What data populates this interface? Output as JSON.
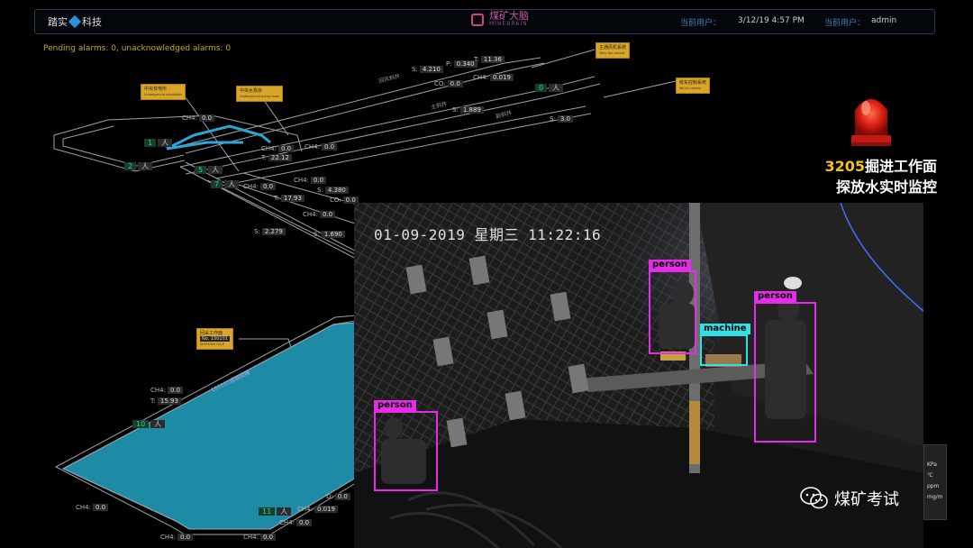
{
  "header": {
    "left_logo_a": "踏实",
    "left_logo_b": "科技",
    "brand_name": "煤矿大脑",
    "brand_sub": "MINEBRAIN",
    "user_label_1": "当前用户：",
    "datetime": "3/12/19 4:57 PM",
    "user_label_2": "当前用户：",
    "username": "admin"
  },
  "alarm_status": "Pending alarms: 0, unacknowledged alarms: 0",
  "map": {
    "boxes": {
      "main_fan": {
        "title": "主通风机系统",
        "sub": "Main fan control"
      },
      "winch": {
        "title": "绞车控制系统",
        "sub": "Winch control"
      },
      "substation": {
        "title": "中央变电所",
        "sub": "Underground substation"
      },
      "pump": {
        "title": "中央水泵房",
        "sub": "Underground pump room"
      },
      "face": {
        "title": "回采工作面",
        "no": "No. 150101",
        "sub": "WORKING FACE"
      }
    },
    "tunnel_labels": {
      "return_air": "回风斜井",
      "main": "主斜井",
      "aux": "副斜井",
      "face_roadway": "150101运输顺槽"
    },
    "readings": {
      "r1_label": "S:",
      "r1": "4.210",
      "r2_label": "P:",
      "r2": "0.340",
      "r3_label": "T:",
      "r3": "11.36",
      "r4_label": "CO:",
      "r4": "0.0",
      "r5_label": "CH4:",
      "r5": "0.019",
      "r6_label": "S:",
      "r6": "1.889",
      "r7_label": "S:",
      "r7": "3.0",
      "r8_label": "CH4:",
      "r8": "0.0",
      "r9_label": "CH4:",
      "r9": "0.0",
      "r10_label": "T:",
      "r10": "22.12",
      "r11_label": "CH4:",
      "r11": "0.0",
      "r12_label": "CH4:",
      "r12": "0.0",
      "r13_label": "CH4:",
      "r13": "0.0",
      "r14_label": "S:",
      "r14": "4.380",
      "r15_label": "T:",
      "r15": "17.93",
      "r16_label": "CO:",
      "r16": "0.0",
      "r17_label": "CH4:",
      "r17": "0.0",
      "r18_label": "S:",
      "r18": "2.279",
      "r19_label": "S:",
      "r19": "1.690",
      "r20_label": "CH4:",
      "r20": "0.0",
      "r21_label": "T:",
      "r21": "15.93",
      "r22_label": "CH4:",
      "r22": "0.0",
      "r23_label": "CH4:",
      "r23": "0.019",
      "r24_label": "CH4:",
      "r24": "0.0",
      "r25_label": "D:",
      "r25": "0.0",
      "r26_label": "CH4:",
      "r26": "0.0",
      "r27_label": "CH4:",
      "r27": "0.0"
    },
    "counts": {
      "unit": "人",
      "c1": "1",
      "c2": "2",
      "c3": "5",
      "c4": "7",
      "c5": "0",
      "c6": "10",
      "c7": "11"
    }
  },
  "title": {
    "line1_num": "3205",
    "line1_text": "掘进工作面",
    "line2": "探放水实时监控"
  },
  "camera": {
    "timestamp": "01-09-2019 星期三 11:22:16",
    "detections": [
      {
        "label": "person",
        "color": "#e62ce6"
      },
      {
        "label": "person",
        "color": "#e62ce6"
      },
      {
        "label": "machine",
        "color": "#2fe0e6"
      },
      {
        "label": "person",
        "color": "#e62ce6"
      }
    ]
  },
  "units": [
    "KPa",
    "℃",
    "ppm",
    "mg/m"
  ],
  "watermark": "煤矿考试",
  "colors": {
    "accent_green": "#1ee07a",
    "label_yellow": "#d9a628",
    "pipe_cyan": "#2aa6d8",
    "face_fill": "#1d8aa6"
  }
}
